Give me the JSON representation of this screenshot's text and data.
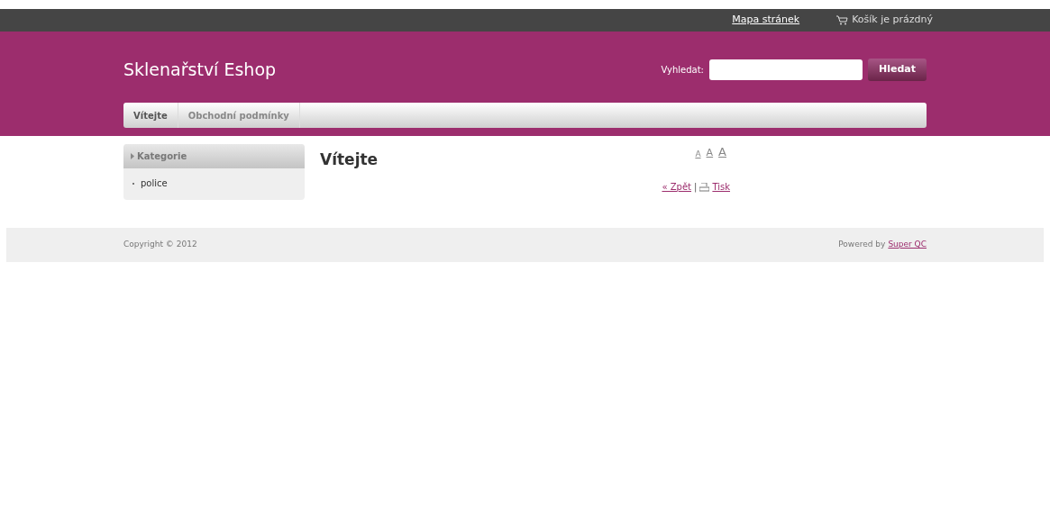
{
  "top_bar": {
    "sitemap_link": "Mapa stránek",
    "cart": "Košík je prázdný"
  },
  "header": {
    "site_title": "Sklenařství Eshop",
    "search": {
      "label": "Vyhledat:",
      "button": "Hledat"
    }
  },
  "nav": [
    {
      "label": "Vítejte",
      "selected": true
    },
    {
      "label": "Obchodní podmínky",
      "selected": false
    }
  ],
  "sidebar": {
    "title": "Kategorie",
    "items": [
      "police"
    ]
  },
  "content": {
    "title": "Vítejte",
    "font_size_buttons": [
      "A",
      "A",
      "A"
    ],
    "back_link": "« Zpět",
    "separator": "|",
    "print_link": "Tisk"
  },
  "footer": {
    "copyright": "Copyright © 2012",
    "powered_by": "Powered by",
    "powered_link": "Super QC"
  }
}
